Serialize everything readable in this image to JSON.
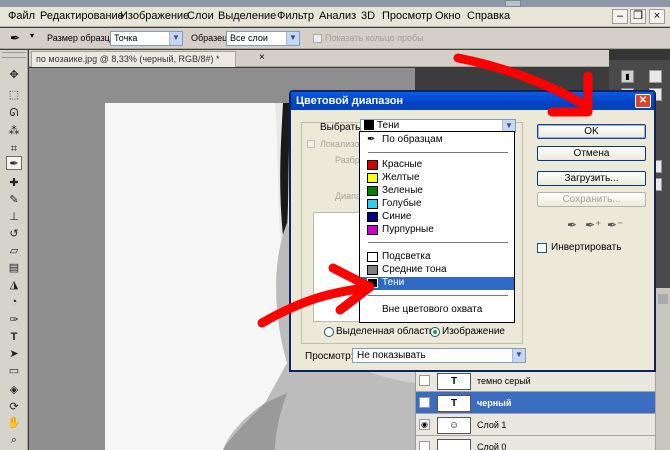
{
  "menu": [
    "Файл",
    "Редактирование",
    "Изображение",
    "Слои",
    "Выделение",
    "Фильтр",
    "Анализ",
    "3D",
    "Просмотр",
    "Окно",
    "Справка"
  ],
  "options_bar": {
    "sample_size_label": "Размер образца:",
    "sample_size_value": "Точка",
    "sample_label": "Образец:",
    "sample_value": "Все слои",
    "sample_merged_label": "Показать кольцо пробы"
  },
  "document": {
    "tab_title": "по мозаике.jpg @ 8,33% (черный, RGB/8#) *",
    "close_glyph": "×"
  },
  "layers": [
    {
      "name": "темно серый",
      "thumb": "T",
      "selected": false,
      "visible": false
    },
    {
      "name": "черный",
      "thumb": "T",
      "selected": true,
      "visible": false
    },
    {
      "name": "Слой 1",
      "thumb": "",
      "selected": false,
      "visible": true
    },
    {
      "name": "Слой 0",
      "thumb": "",
      "selected": false,
      "visible": false
    }
  ],
  "dialog": {
    "title": "Цветовой диапазон",
    "select_label": "Выбрать:",
    "select_value": "Тени",
    "select_color": "#000000",
    "localized_label": "Локализо",
    "fuzziness_label": "Разбро",
    "range_label": "Диапа",
    "radio_selection": "Выделенная область",
    "radio_image": "Изображение",
    "ok": "OK",
    "cancel": "Отмена",
    "load": "Загрузить...",
    "save": "Сохранить...",
    "invert": "Инвертировать",
    "preview_label": "Просмотр:",
    "preview_value": "Не показывать"
  },
  "dropdown": {
    "sampled": "По образцам",
    "colors": [
      {
        "label": "Красные",
        "color": "#d40000"
      },
      {
        "label": "Желтые",
        "color": "#ffff00"
      },
      {
        "label": "Зеленые",
        "color": "#008000"
      },
      {
        "label": "Голубые",
        "color": "#33ccee"
      },
      {
        "label": "Синие",
        "color": "#000080"
      },
      {
        "label": "Пурпурные",
        "color": "#cc00cc"
      }
    ],
    "tones": [
      {
        "label": "Подсветка",
        "color": "#ffffff"
      },
      {
        "label": "Средние тона",
        "color": "#808080"
      },
      {
        "label": "Тени",
        "color": "#000000",
        "highlighted": true
      }
    ],
    "out_of_gamut": "Вне цветового охвата"
  },
  "annotation_color": "#ff0000"
}
